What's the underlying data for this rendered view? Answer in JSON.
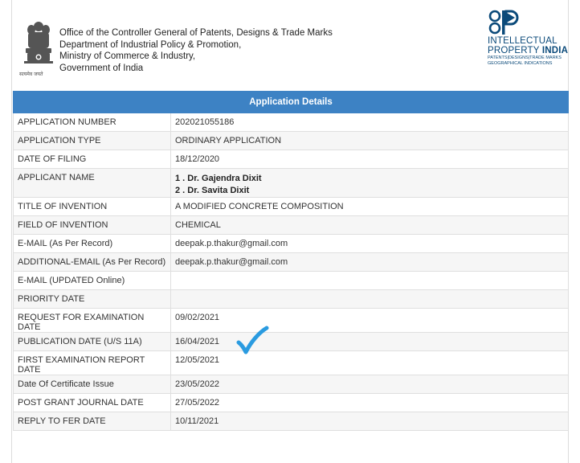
{
  "header": {
    "office_lines": [
      "Office of the Controller General of Patents, Designs & Trade Marks",
      "Department of Industrial Policy & Promotion,",
      "Ministry of Commerce & Industry,",
      "Government of India"
    ],
    "emblem_caption": "सत्यमेव जयते",
    "logo_line1": "INTELLECTUAL",
    "logo_line2a": "PROPERTY ",
    "logo_line2b": "INDIA",
    "logo_small1": "PATENTS|DESIGNS|TRADE MARKS",
    "logo_small2": "GEOGRAPHICAL INDICATIONS"
  },
  "table": {
    "title": "Application Details",
    "rows": [
      {
        "label": "APPLICATION NUMBER",
        "value": "202021055186"
      },
      {
        "label": "APPLICATION TYPE",
        "value": "ORDINARY APPLICATION"
      },
      {
        "label": "DATE OF FILING",
        "value": "18/12/2020"
      },
      {
        "label": "APPLICANT NAME",
        "value": [
          "1 . Dr. Gajendra Dixit",
          "2 . Dr. Savita Dixit"
        ]
      },
      {
        "label": "TITLE OF INVENTION",
        "value": "A MODIFIED CONCRETE COMPOSITION"
      },
      {
        "label": "FIELD OF INVENTION",
        "value": "CHEMICAL"
      },
      {
        "label": "E-MAIL (As Per Record)",
        "value": "deepak.p.thakur@gmail.com"
      },
      {
        "label": "ADDITIONAL-EMAIL (As Per Record)",
        "value": "deepak.p.thakur@gmail.com"
      },
      {
        "label": "E-MAIL (UPDATED Online)",
        "value": ""
      },
      {
        "label": "PRIORITY DATE",
        "value": ""
      },
      {
        "label": "REQUEST FOR EXAMINATION DATE",
        "value": "09/02/2021"
      },
      {
        "label": "PUBLICATION DATE (U/S 11A)",
        "value": "16/04/2021"
      },
      {
        "label": "FIRST EXAMINATION REPORT DATE",
        "value": "12/05/2021"
      },
      {
        "label": "Date Of Certificate Issue",
        "value": "23/05/2022"
      },
      {
        "label": "POST GRANT JOURNAL DATE",
        "value": "27/05/2022"
      },
      {
        "label": "REPLY TO FER DATE",
        "value": "10/11/2021"
      }
    ]
  },
  "colors": {
    "header_bar": "#3d82c4",
    "logo_blue": "#0b4a7a",
    "checkmark": "#2a9be0"
  }
}
